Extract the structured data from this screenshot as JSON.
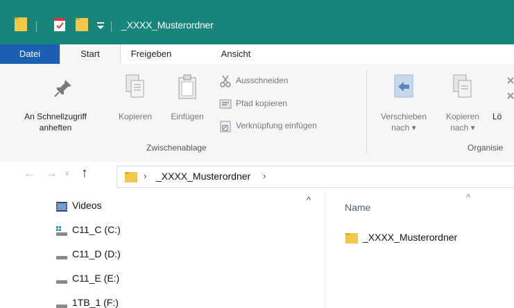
{
  "window": {
    "title": "_XXXX_Musterordner"
  },
  "quick_access": {
    "icons": [
      "folder-icon",
      "properties-checkmark-icon",
      "new-folder-icon",
      "customize-dropdown-icon"
    ]
  },
  "ribbon_tabs": {
    "file": "Datei",
    "start": "Start",
    "share": "Freigeben",
    "view": "Ansicht"
  },
  "ribbon": {
    "pin_line1": "An Schnellzugriff",
    "pin_line2": "anheften",
    "copy": "Kopieren",
    "paste": "Einfügen",
    "cut": "Ausschneiden",
    "copy_path": "Pfad kopieren",
    "paste_shortcut": "Verknüpfung einfügen",
    "clipboard_group": "Zwischenablage",
    "move_to_line1": "Verschieben",
    "move_to_line2": "nach",
    "copy_to_line1": "Kopieren",
    "copy_to_line2": "nach",
    "delete": "Lö",
    "organize_group": "Organisie"
  },
  "address_bar": {
    "path_segment": "_XXXX_Musterordner",
    "separator": "›"
  },
  "navigation_pane": {
    "items": [
      {
        "label": "Videos",
        "icon": "videos-icon"
      },
      {
        "label": "C11_C (C:)",
        "icon": "system-drive-icon"
      },
      {
        "label": "C11_D (D:)",
        "icon": "drive-icon"
      },
      {
        "label": "C11_E (E:)",
        "icon": "drive-icon"
      },
      {
        "label": "1TB_1 (F:)",
        "icon": "drive-icon"
      }
    ]
  },
  "file_list": {
    "column_name": "Name",
    "items": [
      {
        "name": "_XXXX_Musterordner",
        "icon": "folder-icon"
      }
    ]
  },
  "colors": {
    "title_bar": "#18857a",
    "file_tab": "#1a5fb5",
    "folder": "#f4c84a"
  }
}
